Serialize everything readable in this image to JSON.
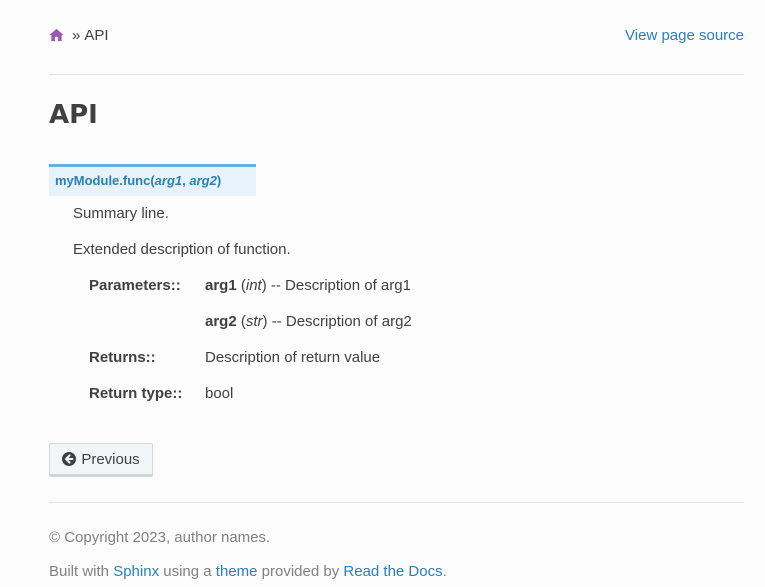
{
  "breadcrumbs": {
    "separator": "»",
    "current": "API",
    "view_source": "View page source"
  },
  "title": "API",
  "signature": {
    "name": "myModule.func(",
    "arg1": "arg1",
    "comma": ", ",
    "arg2": "arg2",
    "close": ")"
  },
  "summary": "Summary line.",
  "extended": "Extended description of function.",
  "fields": {
    "parameters_label": "Parameters::",
    "params": [
      {
        "name": "arg1",
        "open": " (",
        "type": "int",
        "close": ")",
        "desc": " -- Description of arg1"
      },
      {
        "name": "arg2",
        "open": " (",
        "type": "str",
        "close": ")",
        "desc": " -- Description of arg2"
      }
    ],
    "returns_label": "Returns::",
    "returns_value": "Description of return value",
    "return_type_label": "Return type::",
    "return_type_value": "bool"
  },
  "nav": {
    "previous_label": "Previous"
  },
  "footer": {
    "copyright": "© Copyright 2023, author names.",
    "built_prefix": "Built with ",
    "sphinx": "Sphinx",
    "using_a": " using a ",
    "theme": "theme",
    "provided_by": " provided by ",
    "rtd": "Read the Docs",
    "end": "."
  },
  "colors": {
    "link": "#2980b9",
    "home_icon": "#9b59b6",
    "sig_bg": "#e7f2fa",
    "sig_border": "#6ab0de"
  },
  "icons": {
    "home": "home-icon",
    "previous": "circle-arrow-left-icon"
  }
}
